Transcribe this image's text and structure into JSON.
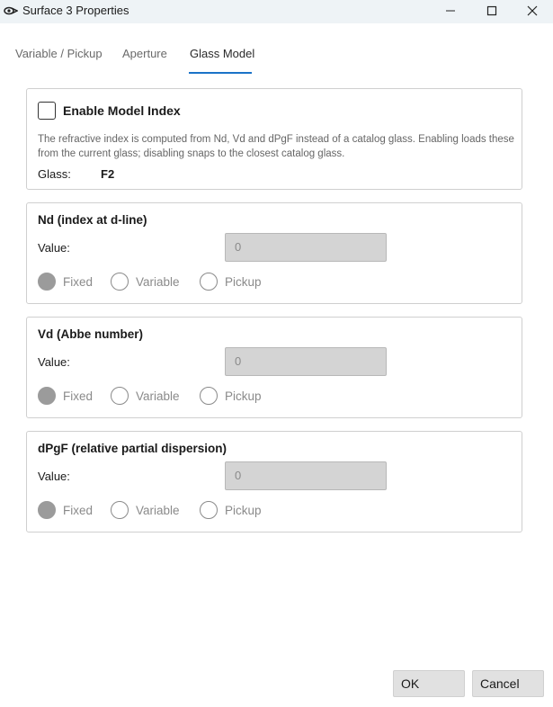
{
  "window": {
    "title": "Surface 3 Properties",
    "icon": "app-icon"
  },
  "tabs": [
    {
      "label": "Variable / Pickup",
      "active": false
    },
    {
      "label": "Aperture",
      "active": false
    },
    {
      "label": "Glass Model",
      "active": true
    }
  ],
  "model": {
    "enable_label": "Enable Model Index",
    "enabled": false,
    "description": "The refractive index is computed from Nd, Vd and dPgF instead of a catalog glass. Enabling loads these from the current glass; disabling snaps to the closest catalog glass.",
    "glass_label": "Glass:",
    "glass_value": "F2"
  },
  "groups": [
    {
      "title": "Nd (index at d-line)",
      "value_label": "Value:",
      "value": "0",
      "options": [
        "Fixed",
        "Variable",
        "Pickup"
      ],
      "selected": "Fixed"
    },
    {
      "title": "Vd (Abbe number)",
      "value_label": "Value:",
      "value": "0",
      "options": [
        "Fixed",
        "Variable",
        "Pickup"
      ],
      "selected": "Fixed"
    },
    {
      "title": "dPgF (relative partial dispersion)",
      "value_label": "Value:",
      "value": "0",
      "options": [
        "Fixed",
        "Variable",
        "Pickup"
      ],
      "selected": "Fixed"
    }
  ],
  "buttons": {
    "ok": "OK",
    "cancel": "Cancel"
  },
  "colors": {
    "accent": "#1a73c8",
    "titlebar": "#eef3f6",
    "disabled_input": "#d4d4d4"
  }
}
